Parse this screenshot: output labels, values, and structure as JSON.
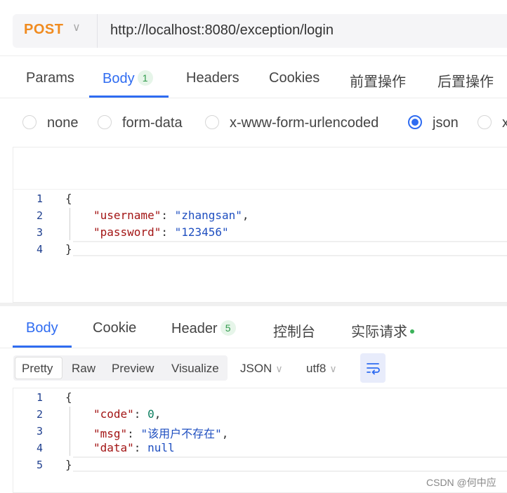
{
  "request": {
    "method": "POST",
    "url": "http://localhost:8080/exception/login"
  },
  "request_tabs": [
    {
      "label": "Params"
    },
    {
      "label": "Body",
      "badge": "1",
      "active": true
    },
    {
      "label": "Headers"
    },
    {
      "label": "Cookies"
    },
    {
      "label": "前置操作"
    },
    {
      "label": "后置操作"
    }
  ],
  "body_types": [
    {
      "label": "none"
    },
    {
      "label": "form-data"
    },
    {
      "label": "x-www-form-urlencoded"
    },
    {
      "label": "json",
      "selected": true
    },
    {
      "label": "x"
    }
  ],
  "request_body": {
    "line_numbers": [
      "1",
      "2",
      "3",
      "4"
    ],
    "brace_open": "{",
    "brace_close": "}",
    "fields": [
      {
        "key": "\"username\"",
        "value": "\"zhangsan\"",
        "trail": ","
      },
      {
        "key": "\"password\"",
        "value": "\"123456\"",
        "trail": ""
      }
    ]
  },
  "response_tabs": [
    {
      "label": "Body",
      "active": true
    },
    {
      "label": "Cookie"
    },
    {
      "label": "Header",
      "badge": "5"
    },
    {
      "label": "控制台"
    },
    {
      "label": "实际请求",
      "dot": true
    }
  ],
  "view_modes": [
    {
      "label": "Pretty",
      "active": true
    },
    {
      "label": "Raw"
    },
    {
      "label": "Preview"
    },
    {
      "label": "Visualize"
    }
  ],
  "format_select": "JSON",
  "encoding_select": "utf8",
  "response_body": {
    "line_numbers": [
      "1",
      "2",
      "3",
      "4",
      "5"
    ],
    "brace_open": "{",
    "brace_close": "}",
    "code_key": "\"code\"",
    "code_value": "0",
    "msg_key": "\"msg\"",
    "msg_value": "\"该用户不存在\"",
    "data_key": "\"data\"",
    "data_value": "null"
  },
  "watermark": "CSDN @何中应",
  "colors": {
    "accent": "#2f6cf1",
    "method": "#f08b1f",
    "json_key": "#a31515",
    "json_string": "#1f4fc0",
    "json_number": "#0b7d5e"
  }
}
